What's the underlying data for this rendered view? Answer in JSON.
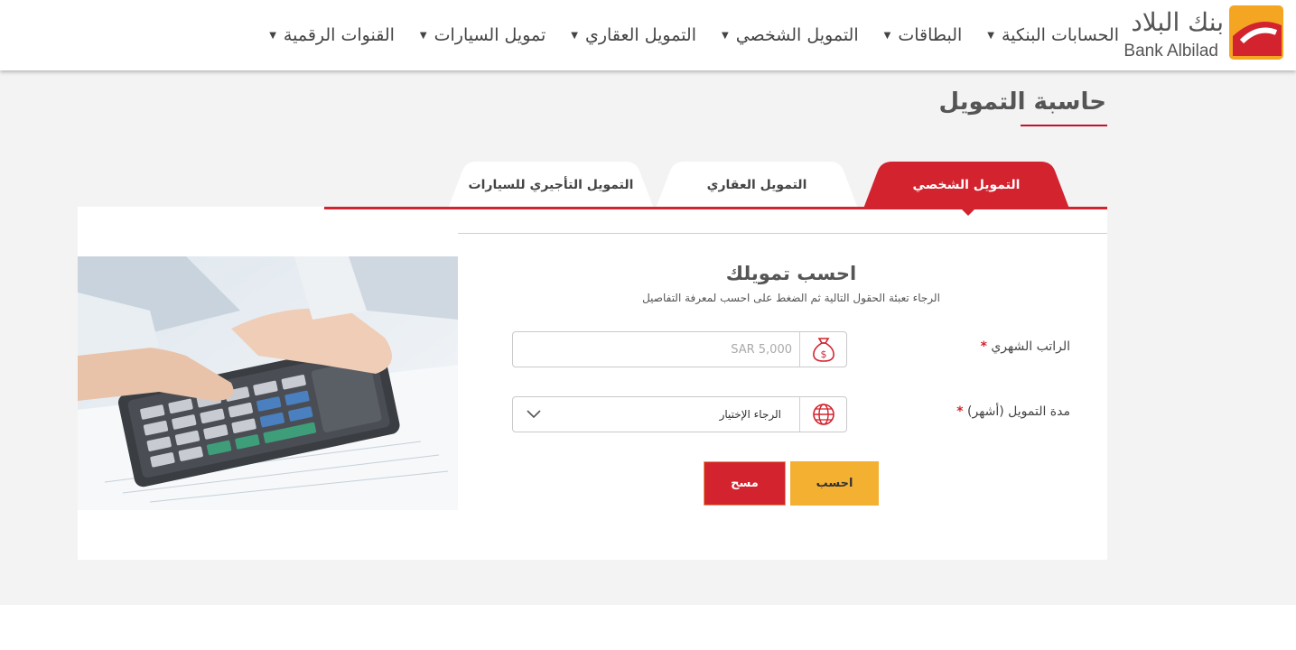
{
  "brand": {
    "name_ar": "بنك البلاد",
    "name_en": "Bank Albilad",
    "colors": {
      "primary": "#d2232f",
      "accent": "#f4b031",
      "logo_orange": "#f4a623"
    }
  },
  "nav": {
    "items": [
      {
        "label": "الحسابات البنكية"
      },
      {
        "label": "البطاقات"
      },
      {
        "label": "التمويل الشخصي"
      },
      {
        "label": "التمويل العقاري"
      },
      {
        "label": "تمويل السيارات"
      },
      {
        "label": "القنوات الرقمية"
      }
    ],
    "caret_icon": "caret-down-icon"
  },
  "page": {
    "title": "حاسبة التمويل"
  },
  "tabs": [
    {
      "label": "التمويل الشخصي",
      "active": true
    },
    {
      "label": "التمويل العقاري",
      "active": false
    },
    {
      "label": "التمويل التأجيري للسيارات",
      "active": false
    }
  ],
  "form": {
    "title": "احسب تمويلك",
    "subtitle": "الرجاء تعبئة الحقول التالية ثم الضغط على احسب لمعرفة التفاصيل",
    "salary": {
      "label": "الراتب الشهري",
      "required_mark": "*",
      "placeholder": "SAR 5,000",
      "value": "",
      "icon": "money-bag-icon"
    },
    "duration": {
      "label": "مدة التمويل (أشهر)",
      "required_mark": "*",
      "selected": "الرجاء الإختيار",
      "icon": "globe-icon"
    },
    "calculate_label": "احسب",
    "clear_label": "مسح"
  }
}
